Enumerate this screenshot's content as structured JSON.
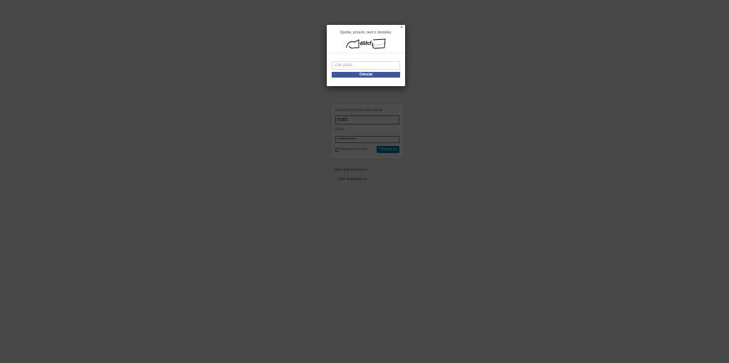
{
  "login": {
    "username_label": "Uživatelské jméno nebo email",
    "username_value": "todd",
    "password_label": "Heslo",
    "password_value": "••••••••••",
    "remember_label": "Pamatovat si mě",
    "submit_label": "Přihlásit se"
  },
  "links": {
    "forgot_password": "Zapomněli jste heslo?",
    "back_to_site": "← Zpět: Akademie.cz"
  },
  "modal": {
    "title": "Opište, prosím, text z obrázku:",
    "captcha_text": "d5fcf",
    "input_placeholder": "Zde pište...",
    "send_button": "Odeslat",
    "close_symbol": "×"
  }
}
